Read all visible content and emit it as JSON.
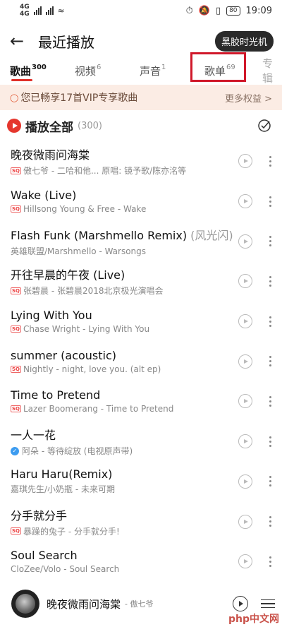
{
  "status_bar": {
    "net1": "4G",
    "net2": "4G",
    "time": "19:09",
    "battery": "80"
  },
  "header": {
    "back_icon": "arrow-left-icon",
    "title": "最近播放",
    "vinyl_button": "黑胶时光机"
  },
  "tabs": [
    {
      "label": "歌曲",
      "count": "300",
      "active": true
    },
    {
      "label": "视频",
      "count": "6",
      "active": false
    },
    {
      "label": "声音",
      "count": "1",
      "active": false
    },
    {
      "label": "歌单",
      "count": "69",
      "active": false
    },
    {
      "label": "专辑",
      "count": "",
      "active": false
    }
  ],
  "vip_banner": {
    "text": "您已畅享17首VIP专享歌曲",
    "more": "更多权益 >"
  },
  "play_all": {
    "label": "播放全部",
    "count": "(300)"
  },
  "songs": [
    {
      "title": "晚夜微雨问海棠",
      "alt": "",
      "badge": "sq",
      "sub": "傲七爷 - 二哈和他... 原唱: 镜予歌/陈亦洺等"
    },
    {
      "title": "Wake (Live)",
      "alt": "",
      "badge": "sq",
      "sub": "Hillsong Young & Free - Wake"
    },
    {
      "title": "Flash Funk (Marshmello Remix)",
      "alt": " (风光闪)",
      "badge": "",
      "sub": "英雄联盟/Marshmello - Warsongs"
    },
    {
      "title": "开往早晨的午夜 (Live)",
      "alt": "",
      "badge": "sq",
      "sub": "张碧晨 - 张碧晨2018北京极光演唱会"
    },
    {
      "title": "Lying With You",
      "alt": "",
      "badge": "sq",
      "sub": "Chase Wright - Lying With You"
    },
    {
      "title": "summer (acoustic)",
      "alt": "",
      "badge": "sq",
      "sub": "Nightly - night, love you. (alt ep)"
    },
    {
      "title": "Time to Pretend",
      "alt": "",
      "badge": "sq",
      "sub": "Lazer Boomerang - Time to Pretend"
    },
    {
      "title": "一人一花",
      "alt": "",
      "badge": "verified",
      "sub": "阿朵 - 等待绽放 (电视原声带)"
    },
    {
      "title": "Haru Haru(Remix)",
      "alt": "",
      "badge": "",
      "sub": "嘉琪先生/小奶瓶 - 未来可期"
    },
    {
      "title": "分手就分手",
      "alt": "",
      "badge": "sq",
      "sub": "暴躁的兔子 - 分手就分手!"
    },
    {
      "title": "Soul Search",
      "alt": "",
      "badge": "",
      "sub": "CloZee/Volo - Soul Search"
    }
  ],
  "mini_player": {
    "title": "晚夜微雨问海棠",
    "artist": "- 傲七爷"
  },
  "watermark": "php中文网",
  "colors": {
    "accent": "#e5362d",
    "highlight_box": "#d0182a",
    "vip_bg": "#fbece4"
  }
}
